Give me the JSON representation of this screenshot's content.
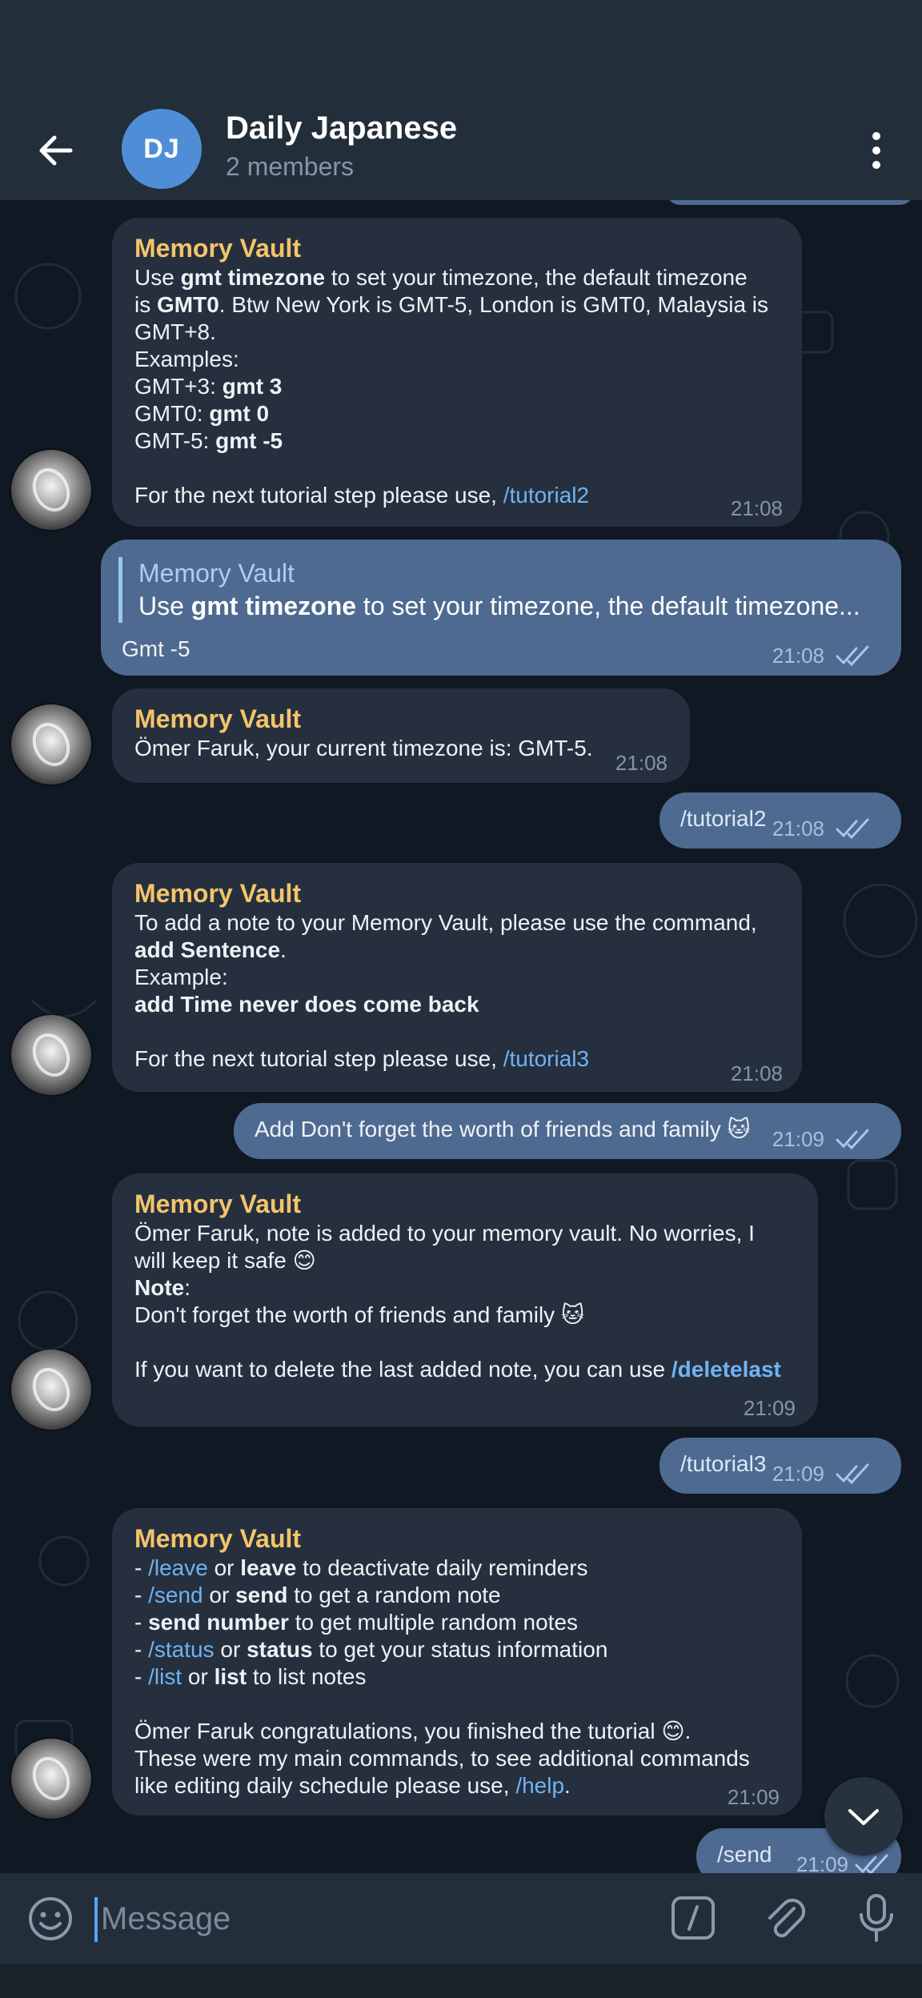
{
  "header": {
    "avatar_initials": "DJ",
    "title": "Daily Japanese",
    "subtitle": "2 members"
  },
  "messages": {
    "m1": {
      "sender": "Memory Vault",
      "time": "21:08",
      "link": "/tutorial2"
    },
    "m2": {
      "quote_name": "Memory Vault",
      "quote_text_pre": "Use ",
      "quote_text_bold": "gmt timezone",
      "quote_text_post": " to set your timezone, the default timezone...",
      "text": "Gmt -5",
      "time": "21:08"
    },
    "m3": {
      "sender": "Memory Vault",
      "text": "Ömer Faruk, your current timezone is: GMT-5.",
      "time": "21:08"
    },
    "m4": {
      "text": "/tutorial2",
      "time": "21:08"
    },
    "m5": {
      "sender": "Memory Vault",
      "time": "21:08",
      "link": "/tutorial3"
    },
    "m6": {
      "text": "Add Don't forget the worth of friends and family 🐱",
      "time": "21:09"
    },
    "m7": {
      "sender": "Memory Vault",
      "time": "21:09",
      "link": "/deletelast"
    },
    "m8": {
      "text": "/tutorial3",
      "time": "21:09"
    },
    "m9": {
      "sender": "Memory Vault",
      "time": "21:09",
      "link": "/help"
    },
    "m10": {
      "text": "/send",
      "time": "21:09"
    }
  },
  "input": {
    "placeholder": "Message"
  },
  "colors": {
    "accent": "#5aa6f0",
    "sender_name": "#f3c46b",
    "outgoing_bubble": "#4e6a90",
    "incoming_bubble": "#262f3d"
  },
  "icons": [
    "back-arrow-icon",
    "more-vertical-icon",
    "chevron-down-icon",
    "emoji-icon",
    "command-slash-icon",
    "paperclip-icon",
    "microphone-icon",
    "double-check-icon"
  ]
}
